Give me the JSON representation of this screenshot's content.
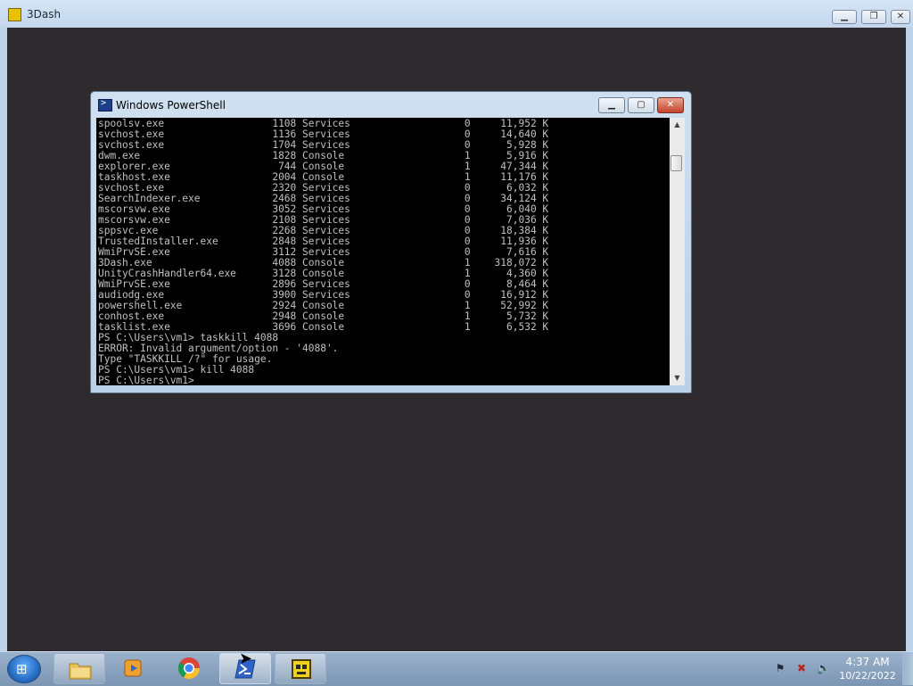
{
  "outer_window": {
    "title": "3Dash",
    "minimize_glyph": "▁",
    "maximize_glyph": "❐",
    "close_glyph": "✕"
  },
  "powershell": {
    "title": "Windows PowerShell",
    "minimize_glyph": "▁",
    "maximize_glyph": "▢",
    "close_glyph": "✕",
    "console_lines": [
      "spoolsv.exe                  1108 Services                   0     11,952 K",
      "svchost.exe                  1136 Services                   0     14,640 K",
      "svchost.exe                  1704 Services                   0      5,928 K",
      "dwm.exe                      1828 Console                    1      5,916 K",
      "explorer.exe                  744 Console                    1     47,344 K",
      "taskhost.exe                 2004 Console                    1     11,176 K",
      "svchost.exe                  2320 Services                   0      6,032 K",
      "SearchIndexer.exe            2468 Services                   0     34,124 K",
      "mscorsvw.exe                 3052 Services                   0      6,040 K",
      "mscorsvw.exe                 2108 Services                   0      7,036 K",
      "sppsvc.exe                   2268 Services                   0     18,384 K",
      "TrustedInstaller.exe         2848 Services                   0     11,936 K",
      "WmiPrvSE.exe                 3112 Services                   0      7,616 K",
      "3Dash.exe                    4088 Console                    1    318,072 K",
      "UnityCrashHandler64.exe      3128 Console                    1      4,360 K",
      "WmiPrvSE.exe                 2896 Services                   0      8,464 K",
      "audiodg.exe                  3900 Services                   0     16,912 K",
      "powershell.exe               2924 Console                    1     52,992 K",
      "conhost.exe                  2948 Console                    1      5,732 K",
      "tasklist.exe                 3696 Console                    1      6,532 K",
      "PS C:\\Users\\vm1> taskkill 4088",
      "ERROR: Invalid argument/option - '4088'.",
      "Type \"TASKKILL /?\" for usage.",
      "PS C:\\Users\\vm1> kill 4088",
      "PS C:\\Users\\vm1>"
    ],
    "scroll_up_glyph": "▲",
    "scroll_down_glyph": "▼"
  },
  "taskbar": {
    "start_glyph": "⊞",
    "items": [
      {
        "name": "windows-explorer",
        "icon": "folder-icon"
      },
      {
        "name": "media-player",
        "icon": "media-player-icon"
      },
      {
        "name": "chrome",
        "icon": "chrome-icon"
      },
      {
        "name": "powershell",
        "icon": "powershell-icon"
      },
      {
        "name": "3dash",
        "icon": "3dash-icon"
      }
    ],
    "clock_time": "4:37 AM",
    "clock_date": "10/22/2022"
  }
}
